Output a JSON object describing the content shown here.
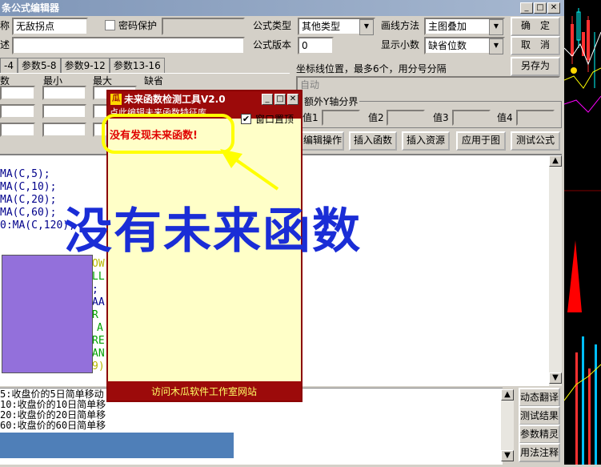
{
  "window": {
    "title": "条件公式编辑器",
    "title_visible": "条公式编辑器"
  },
  "form": {
    "name_label": "称",
    "name_value": "无敌拐点",
    "password_label": "密码保护",
    "formula_type_label": "公式类型",
    "formula_type_value": "其他类型",
    "draw_method_label": "画线方法",
    "draw_method_value": "主图叠加",
    "confirm_button": "确　定",
    "desc_label": "述",
    "formula_version_label": "公式版本",
    "formula_version_value": "0",
    "decimals_label": "显示小数",
    "decimals_value": "缺省位数",
    "cancel_button": "取　消",
    "save_as_button": "另存为"
  },
  "param_tabs": [
    "-4",
    "参数5-8",
    "参数9-12",
    "参数13-16"
  ],
  "param_headers": [
    "数",
    "最小",
    "最大",
    "缺省"
  ],
  "axis": {
    "hint": "坐标线位置，最多6个，用分号分隔",
    "auto_value": "自动",
    "extra_y_label": "额外Y轴分界",
    "values": [
      "值1",
      "值2",
      "值3",
      "值4"
    ]
  },
  "toolbar": [
    "编辑操作",
    "插入函数",
    "插入资源",
    "应用于图",
    "测试公式"
  ],
  "code_lines": [
    "MA(C,5);",
    "MA(C,10);",
    "MA(C,20);",
    "MA(C,60);",
    "0:MA(C,120);"
  ],
  "code_fragments": [
    "OW",
    "LL",
    ";",
    "AA",
    "R",
    "A",
    "RE",
    "AN",
    "9)"
  ],
  "bottom_text": [
    "5:收盘价的5日简单移动",
    "10:收盘价的10日简单移",
    "20:收盘价的20日简单移",
    "60:收盘价的60日简单移"
  ],
  "right_buttons": [
    "动态翻译",
    "测试结果",
    "参数精灵",
    "用法注释"
  ],
  "popup": {
    "icon": "瓜",
    "title": "未来函数检测工具V2.0",
    "subtitle": "点此编辑未来函数特征库",
    "topmost_label": "窗口置顶",
    "result": "没有发现未来函数!",
    "footer_link": "访问木瓜软件工作室网站"
  },
  "annotation": "没有未来函数",
  "colors": {
    "accent_blue": "#1a2dd6",
    "popup_red": "#9c0a0a",
    "purple_block": "#9370db",
    "blue_block": "#4f7fb8"
  }
}
